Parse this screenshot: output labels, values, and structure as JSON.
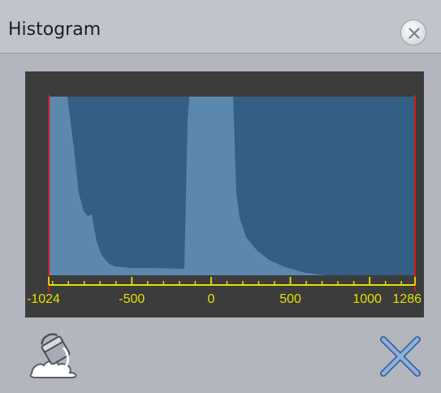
{
  "window": {
    "title": "Histogram"
  },
  "histogram": {
    "axis": {
      "min": -1024,
      "max": 1286,
      "tick_labels": [
        "-1024",
        "-500",
        "0",
        "500",
        "1000",
        "1286"
      ],
      "tick_values": [
        -1024,
        -500,
        0,
        500,
        1000,
        1286
      ]
    },
    "colors": {
      "background": "#3c3c3c",
      "window_fill": "#325f83",
      "histogram_fill": "#5b88ad",
      "axis": "#e5e000",
      "range_marker": "#d11a1a"
    },
    "range": {
      "low": -1024,
      "high": 1286
    }
  },
  "toolbar": {
    "left_icon": "paint-bucket-icon",
    "right_icon": "x-clear-icon"
  }
}
